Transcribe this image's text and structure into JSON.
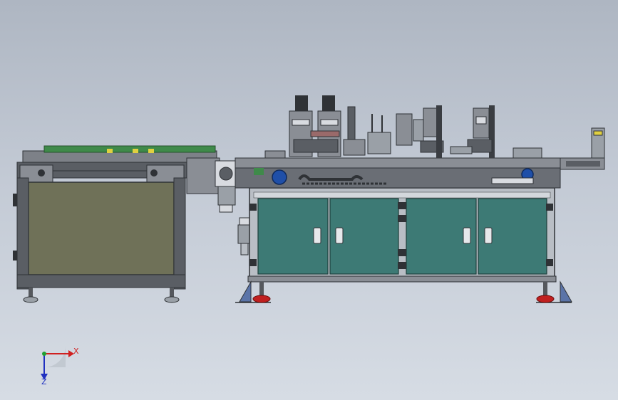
{
  "viewport": {
    "background_top": "#aeb6c2",
    "background_bottom": "#d6dce4"
  },
  "triad": {
    "x_label": "X",
    "z_label": "Z",
    "x_color": "#d02020",
    "y_color": "#20a030",
    "z_color": "#2030c0"
  },
  "machine": {
    "frame_color": "#5a5e64",
    "frame_dark": "#3a3d42",
    "conveyor_panel_color": "#6f7158",
    "cabinet_door_color": "#3d7a75",
    "cabinet_frame_color": "#b9bec5",
    "rail_green": "#3f8a4a",
    "foot_red": "#c02020",
    "motor_blue": "#1f4fa8",
    "plate_yellow": "#e0d040"
  }
}
